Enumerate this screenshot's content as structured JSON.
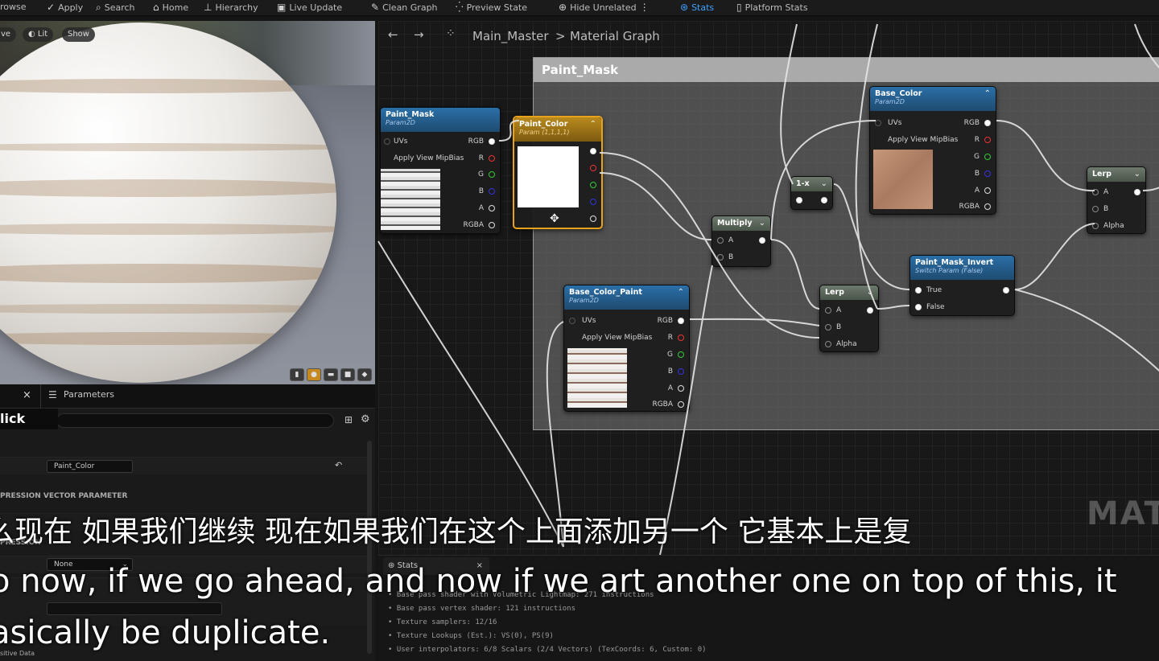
{
  "toolbar": {
    "items": [
      {
        "label": "rowse",
        "icon": "folder-icon"
      },
      {
        "label": "Apply",
        "icon": "check-icon"
      },
      {
        "label": "Search",
        "icon": "search-icon"
      },
      {
        "label": "Home",
        "icon": "home-icon"
      },
      {
        "label": "Hierarchy",
        "icon": "hierarchy-icon"
      },
      {
        "label": "Live Update",
        "icon": "live-update-icon"
      },
      {
        "label": "Clean Graph",
        "icon": "broom-icon"
      },
      {
        "label": "Preview State",
        "icon": "preview-state-icon"
      },
      {
        "label": "Hide Unrelated",
        "icon": "hide-unrelated-icon"
      },
      {
        "label": "Stats",
        "icon": "stats-icon"
      },
      {
        "label": "Platform Stats",
        "icon": "platform-stats-icon"
      }
    ],
    "accent": "#3fa2ff"
  },
  "viewport": {
    "buttons": [
      "ve",
      "Lit",
      "Show"
    ]
  },
  "details": {
    "tabs": {
      "close": "×",
      "parameters": "Parameters"
    },
    "click_label": "lick",
    "param_name_value": "Paint_Color",
    "section1": "PRESSION VECTOR PARAMETER",
    "section2": "PRESSION",
    "select_value": "None",
    "section3": "sitive Data"
  },
  "graph": {
    "breadcrumb": {
      "root": "Main_Master",
      "separator": ">",
      "current": "Material Graph"
    },
    "comment_title": "Paint_Mask",
    "nodes": {
      "paint_mask": {
        "title": "Paint_Mask",
        "subtitle": "Param2D",
        "uvs": "UVs",
        "mip": "Apply View MipBias",
        "rgb": "RGB",
        "r": "R",
        "g": "G",
        "b": "B",
        "a": "A",
        "rgba": "RGBA"
      },
      "paint_color": {
        "title": "Paint_Color",
        "subtitle": "Param (1,1,1,1)"
      },
      "base_color": {
        "title": "Base_Color",
        "subtitle": "Param2D",
        "uvs": "UVs",
        "mip": "Apply View MipBias",
        "rgb": "RGB",
        "r": "R",
        "g": "G",
        "b": "B",
        "a": "A",
        "rgba": "RGBA"
      },
      "one_minus": {
        "title": "1-x"
      },
      "multiply": {
        "title": "Multiply",
        "a": "A",
        "b": "B"
      },
      "lerp1": {
        "title": "Lerp",
        "a": "A",
        "b": "B",
        "alpha": "Alpha"
      },
      "lerp2": {
        "title": "Lerp",
        "a": "A",
        "b": "B",
        "alpha": "Alpha"
      },
      "paint_mask_invert": {
        "title": "Paint_Mask_Invert",
        "subtitle": "Switch Param (False)",
        "true": "True",
        "false": "False"
      },
      "base_color_paint": {
        "title": "Base_Color_Paint",
        "subtitle": "Param2D",
        "uvs": "UVs",
        "mip": "Apply View MipBias",
        "rgb": "RGB",
        "r": "R",
        "g": "G",
        "b": "B",
        "a": "A",
        "rgba": "RGBA"
      }
    },
    "watermark": "MATE"
  },
  "stats": {
    "tab_label": "Stats",
    "lines": [
      "Base pass shader with Volumetric Lightmap: 271 instructions",
      "Base pass vertex shader: 121 instructions",
      "Texture samplers: 12/16",
      "Texture Lookups (Est.): VS(0), PS(9)",
      "User interpolators: 6/8 Scalars (2/4 Vectors) (TexCoords: 6, Custom: 0)"
    ]
  },
  "subtitles": {
    "zh": "么现在 如果我们继续 现在如果我们在这个上面添加另一个 它基本上是复",
    "en_line1": "o now, if we go ahead, and now if we art another one on top of this, it",
    "en_line2": "asically be duplicate."
  }
}
